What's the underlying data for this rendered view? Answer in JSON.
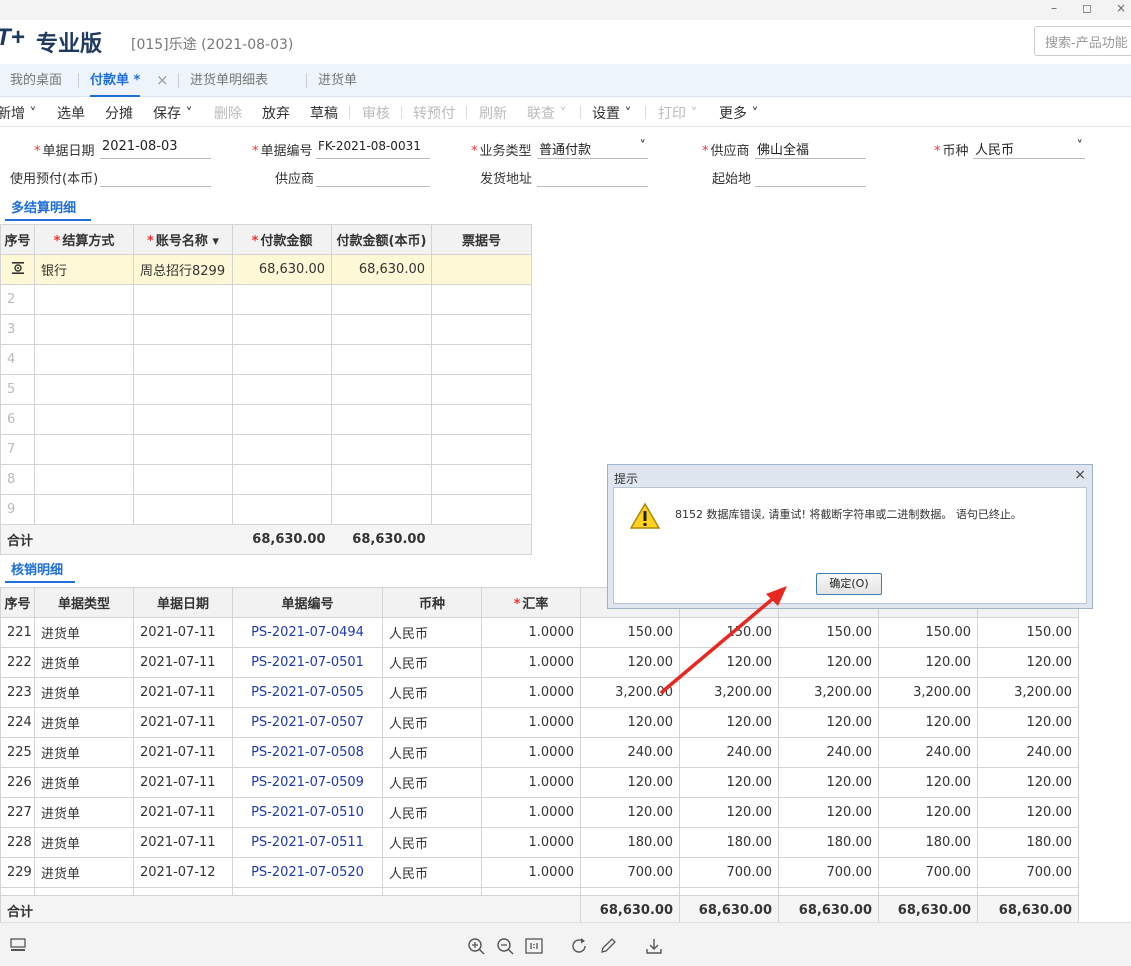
{
  "window": {
    "min": "–",
    "max": "◻",
    "close": "×"
  },
  "header": {
    "logo": "T+",
    "edition": "专业版",
    "company": "[015]乐途  (2021-08-03)",
    "search_placeholder": "搜索-产品功能"
  },
  "tabs": [
    {
      "label": "我的桌面"
    },
    {
      "label": "付款单 *"
    },
    {
      "label": "进货单明细表"
    },
    {
      "label": "进货单"
    }
  ],
  "tab_close": "×",
  "toolbar": {
    "items": [
      "新增",
      "选单",
      "分摊",
      "保存",
      "删除",
      "放弃",
      "草稿",
      "审核",
      "转预付",
      "刷新",
      "联查",
      "设置",
      "打印",
      "更多"
    ]
  },
  "form": {
    "date_label": "单据日期",
    "date_value": "2021-08-03",
    "code_label": "单据编号",
    "code_value": "FK-2021-08-0031",
    "biz_label": "业务类型",
    "biz_value": "普通付款",
    "supplier_label": "供应商",
    "supplier_value": "佛山全福",
    "currency_label": "币种",
    "currency_value": "人民币",
    "prepay_label": "使用预付(本币)",
    "supplier2_label": "供应商",
    "ship_label": "发货地址",
    "origin_label": "起始地"
  },
  "settlement": {
    "tab": "多结算明细",
    "headers": [
      "序号",
      "结算方式",
      "账号名称",
      "付款金额",
      "付款金额(本币)",
      "票据号"
    ],
    "rows": [
      {
        "no": "",
        "method": "银行",
        "account": "周总招行8299",
        "amount": "68,630.00",
        "amount_base": "68,630.00",
        "ticket": ""
      }
    ],
    "empty_rows": [
      "2",
      "3",
      "4",
      "5",
      "6",
      "7",
      "8",
      "9"
    ],
    "total_label": "合计",
    "total_amount": "68,630.00",
    "total_amount_base": "68,630.00"
  },
  "writeoff": {
    "tab": "核销明细",
    "headers": [
      "序号",
      "单据类型",
      "单据日期",
      "单据编号",
      "币种",
      "汇率"
    ],
    "rows": [
      {
        "no": "221",
        "type": "进货单",
        "date": "2021-07-11",
        "code": "PS-2021-07-0494",
        "cur": "人民币",
        "rate": "1.0000",
        "v1": "150.00",
        "v2": "150.00",
        "v3": "150.00",
        "v4": "150.00",
        "v5": "150.00"
      },
      {
        "no": "222",
        "type": "进货单",
        "date": "2021-07-11",
        "code": "PS-2021-07-0501",
        "cur": "人民币",
        "rate": "1.0000",
        "v1": "120.00",
        "v2": "120.00",
        "v3": "120.00",
        "v4": "120.00",
        "v5": "120.00"
      },
      {
        "no": "223",
        "type": "进货单",
        "date": "2021-07-11",
        "code": "PS-2021-07-0505",
        "cur": "人民币",
        "rate": "1.0000",
        "v1": "3,200.00",
        "v2": "3,200.00",
        "v3": "3,200.00",
        "v4": "3,200.00",
        "v5": "3,200.00"
      },
      {
        "no": "224",
        "type": "进货单",
        "date": "2021-07-11",
        "code": "PS-2021-07-0507",
        "cur": "人民币",
        "rate": "1.0000",
        "v1": "120.00",
        "v2": "120.00",
        "v3": "120.00",
        "v4": "120.00",
        "v5": "120.00"
      },
      {
        "no": "225",
        "type": "进货单",
        "date": "2021-07-11",
        "code": "PS-2021-07-0508",
        "cur": "人民币",
        "rate": "1.0000",
        "v1": "240.00",
        "v2": "240.00",
        "v3": "240.00",
        "v4": "240.00",
        "v5": "240.00"
      },
      {
        "no": "226",
        "type": "进货单",
        "date": "2021-07-11",
        "code": "PS-2021-07-0509",
        "cur": "人民币",
        "rate": "1.0000",
        "v1": "120.00",
        "v2": "120.00",
        "v3": "120.00",
        "v4": "120.00",
        "v5": "120.00"
      },
      {
        "no": "227",
        "type": "进货单",
        "date": "2021-07-11",
        "code": "PS-2021-07-0510",
        "cur": "人民币",
        "rate": "1.0000",
        "v1": "120.00",
        "v2": "120.00",
        "v3": "120.00",
        "v4": "120.00",
        "v5": "120.00"
      },
      {
        "no": "228",
        "type": "进货单",
        "date": "2021-07-11",
        "code": "PS-2021-07-0511",
        "cur": "人民币",
        "rate": "1.0000",
        "v1": "180.00",
        "v2": "180.00",
        "v3": "180.00",
        "v4": "180.00",
        "v5": "180.00"
      },
      {
        "no": "229",
        "type": "进货单",
        "date": "2021-07-12",
        "code": "PS-2021-07-0520",
        "cur": "人民币",
        "rate": "1.0000",
        "v1": "700.00",
        "v2": "700.00",
        "v3": "700.00",
        "v4": "700.00",
        "v5": "700.00"
      }
    ],
    "total_label": "合计",
    "totals": [
      "68,630.00",
      "68,630.00",
      "68,630.00",
      "68,630.00",
      "68,630.00"
    ]
  },
  "dialog": {
    "title": "提示",
    "message": "8152 数据库错误, 请重试! 将截断字符串或二进制数据。 语句已终止。",
    "ok": "确定(O)",
    "close": "×"
  },
  "colors": {
    "accent": "#1e6fd9",
    "selected_row": "#fff8d6",
    "arrow": "#e8281f"
  }
}
